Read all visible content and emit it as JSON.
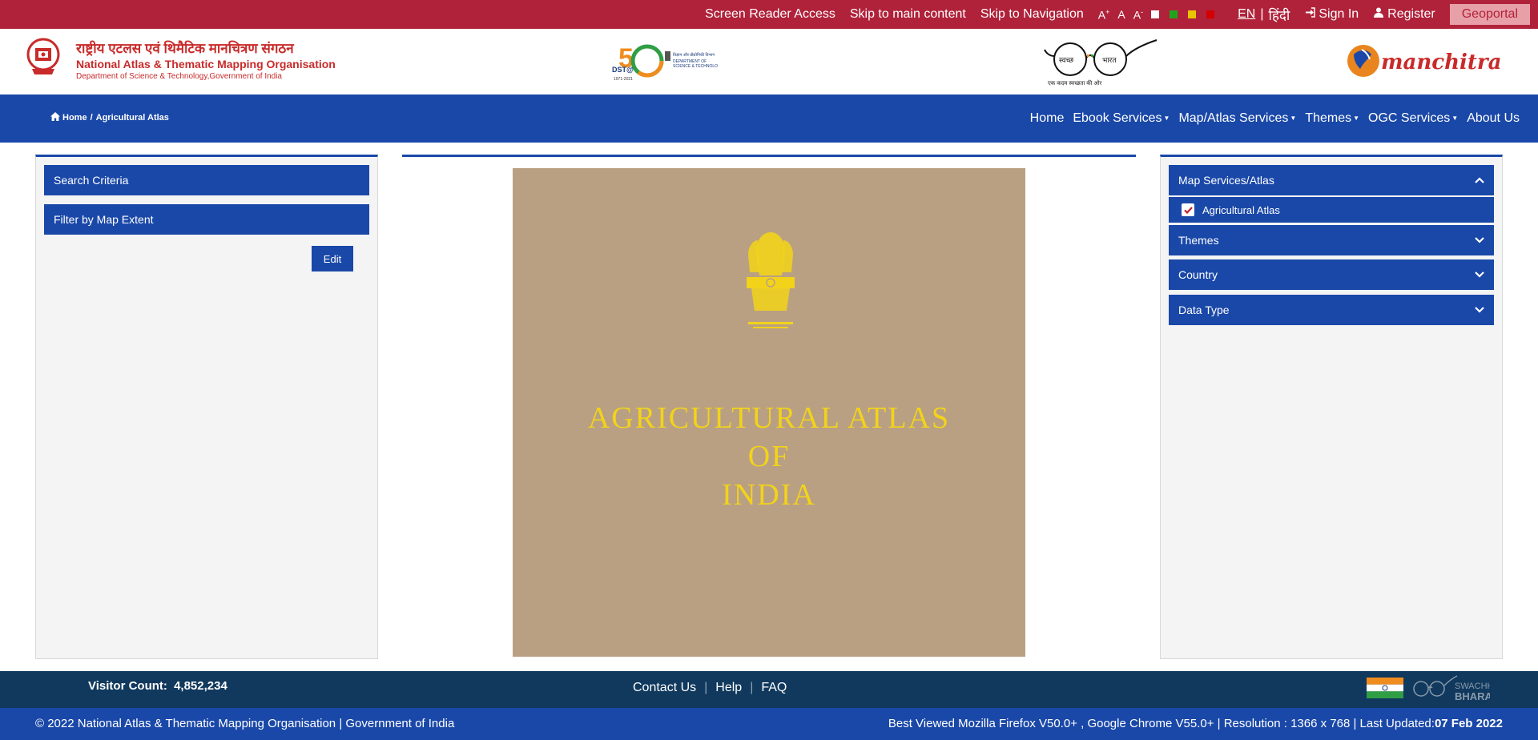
{
  "topbar": {
    "screen_reader": "Screen Reader Access",
    "skip_main": "Skip to main content",
    "skip_nav": "Skip to Navigation",
    "font_increase": "A",
    "font_increase_sup": "+",
    "font_normal": "A",
    "font_decrease": "A",
    "font_decrease_sup": "-",
    "theme_colors": [
      "#ffffff",
      "#1fa31f",
      "#e8c600",
      "#d40000"
    ],
    "lang_en": "EN",
    "lang_sep": "|",
    "lang_hi": "हिंदी",
    "sign_in": "Sign In",
    "register": "Register",
    "geoportal": "Geoportal"
  },
  "header": {
    "org_hindi": "राष्ट्रीय एटलस एवं थिमैटिक मानचित्रण संगठन",
    "org_english": "National Atlas & Thematic Mapping Organisation",
    "org_dept": "Department of Science & Technology,Government of India"
  },
  "navbar": {
    "breadcrumb_home": "Home",
    "breadcrumb_sep": "/",
    "breadcrumb_current": "Agricultural Atlas",
    "menu": [
      {
        "label": "Home",
        "dropdown": false
      },
      {
        "label": "Ebook Services",
        "dropdown": true
      },
      {
        "label": "Map/Atlas Services",
        "dropdown": true
      },
      {
        "label": "Themes",
        "dropdown": true
      },
      {
        "label": "OGC Services",
        "dropdown": true
      },
      {
        "label": "About Us",
        "dropdown": false
      }
    ]
  },
  "left_panel": {
    "search_criteria": "Search Criteria",
    "filter_extent": "Filter by Map Extent",
    "edit_button": "Edit"
  },
  "cover": {
    "line1": "AGRICULTURAL ATLAS",
    "line2": "OF",
    "line3": "INDIA"
  },
  "right_panel": {
    "map_services": "Map Services/Atlas",
    "agricultural_atlas": "Agricultural Atlas",
    "agricultural_atlas_checked": true,
    "themes": "Themes",
    "country": "Country",
    "data_type": "Data Type"
  },
  "footer": {
    "visitor_label": "Visitor Count:",
    "visitor_count": "4,852,234",
    "contact": "Contact Us",
    "help": "Help",
    "faq": "FAQ",
    "copyright": "© 2022 National Atlas & Thematic Mapping Organisation | Government of India",
    "best_viewed": "Best Viewed Mozilla Firefox V50.0+ , Google Chrome V55.0+ | Resolution : 1366 x 768 | Last Updated:",
    "last_updated": "07 Feb 2022"
  }
}
